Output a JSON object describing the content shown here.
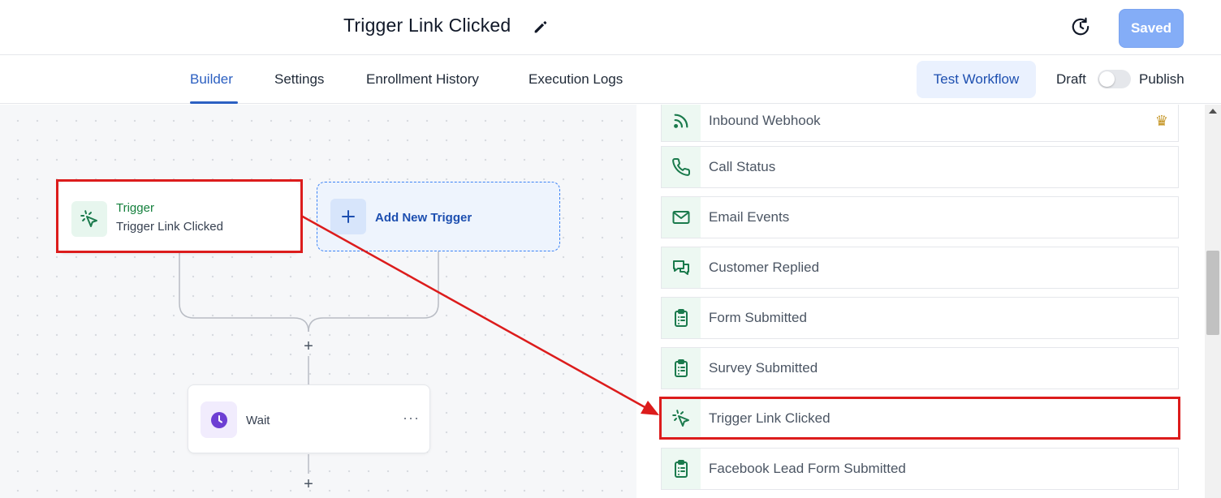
{
  "header": {
    "title": "Trigger Link Clicked",
    "saved_label": "Saved"
  },
  "tabs": [
    {
      "label": "Builder",
      "active": true
    },
    {
      "label": "Settings",
      "active": false
    },
    {
      "label": "Enrollment History",
      "active": false
    },
    {
      "label": "Execution Logs",
      "active": false
    }
  ],
  "actions": {
    "test_label": "Test Workflow",
    "draft_label": "Draft",
    "publish_label": "Publish",
    "publish_toggle_on": false
  },
  "canvas": {
    "trigger_card": {
      "title": "Trigger",
      "subtitle": "Trigger Link Clicked"
    },
    "add_trigger_label": "Add New Trigger",
    "wait_card": {
      "label": "Wait",
      "more": "···"
    }
  },
  "trigger_options": [
    {
      "label": "Inbound Webhook",
      "icon": "rss-icon",
      "premium": true
    },
    {
      "label": "Call Status",
      "icon": "phone-icon",
      "premium": false
    },
    {
      "label": "Email Events",
      "icon": "mail-icon",
      "premium": false
    },
    {
      "label": "Customer Replied",
      "icon": "chat-icon",
      "premium": false
    },
    {
      "label": "Form Submitted",
      "icon": "clipboard-icon",
      "premium": false
    },
    {
      "label": "Survey Submitted",
      "icon": "clipboard-icon",
      "premium": false
    },
    {
      "label": "Trigger Link Clicked",
      "icon": "cursor-click-icon",
      "premium": false,
      "highlighted": true
    },
    {
      "label": "Facebook Lead Form Submitted",
      "icon": "clipboard-icon",
      "premium": false
    }
  ],
  "colors": {
    "accent_blue": "#2b5fc1",
    "highlight_red": "#dc1c1c",
    "trigger_green": "#15803d",
    "icon_green": "#1a7a4c",
    "wait_purple": "#6d3fd3"
  }
}
